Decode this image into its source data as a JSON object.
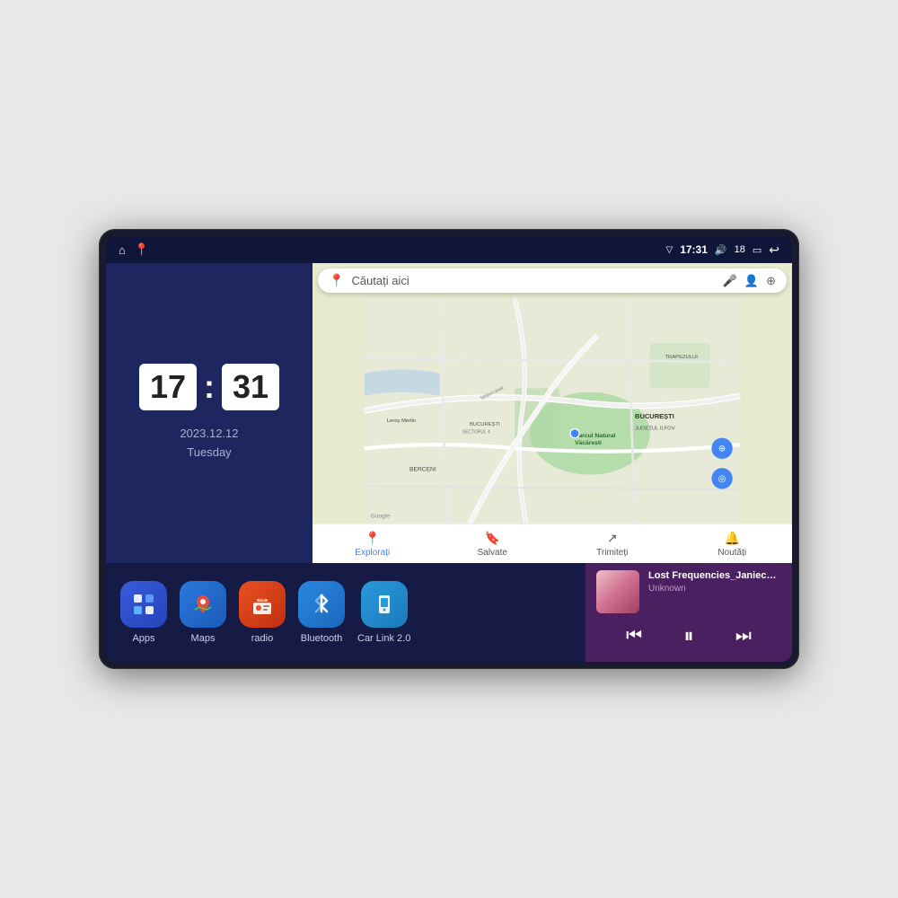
{
  "device": {
    "status_bar": {
      "time": "17:31",
      "signal_icon": "▽",
      "volume_icon": "🔊",
      "battery_value": "18",
      "battery_icon": "▭",
      "back_icon": "↩"
    },
    "home_icons": [
      "⌂",
      "📍"
    ],
    "clock": {
      "hours": "17",
      "minutes": "31",
      "date": "2023.12.12",
      "day": "Tuesday"
    },
    "map": {
      "search_placeholder": "Căutați aici",
      "nav_items": [
        {
          "label": "Explorați",
          "active": true
        },
        {
          "label": "Salvate",
          "active": false
        },
        {
          "label": "Trimiteți",
          "active": false
        },
        {
          "label": "Noutăți",
          "active": false
        }
      ],
      "labels": [
        "Parcul Natural Văcărești",
        "Leroy Merlin",
        "BUCUREȘTI SECTORUL 4",
        "BUCUREȘTI",
        "JUDEȚUL ILFOV",
        "BERCENI",
        "TRAPEZULUI",
        "Splaiul Unirii",
        "Google"
      ]
    },
    "apps": [
      {
        "label": "Apps",
        "icon": "⊞",
        "color": "#3a5bdb"
      },
      {
        "label": "Maps",
        "icon": "📍",
        "color": "#2a7ade"
      },
      {
        "label": "radio",
        "icon": "📻",
        "color": "#e85020"
      },
      {
        "label": "Bluetooth",
        "icon": "🔷",
        "color": "#2a88de"
      },
      {
        "label": "Car Link 2.0",
        "icon": "📱",
        "color": "#2a9adb"
      }
    ],
    "music": {
      "title": "Lost Frequencies_Janieck Devy-...",
      "artist": "Unknown",
      "prev_icon": "⏮",
      "play_icon": "⏸",
      "next_icon": "⏭"
    }
  }
}
